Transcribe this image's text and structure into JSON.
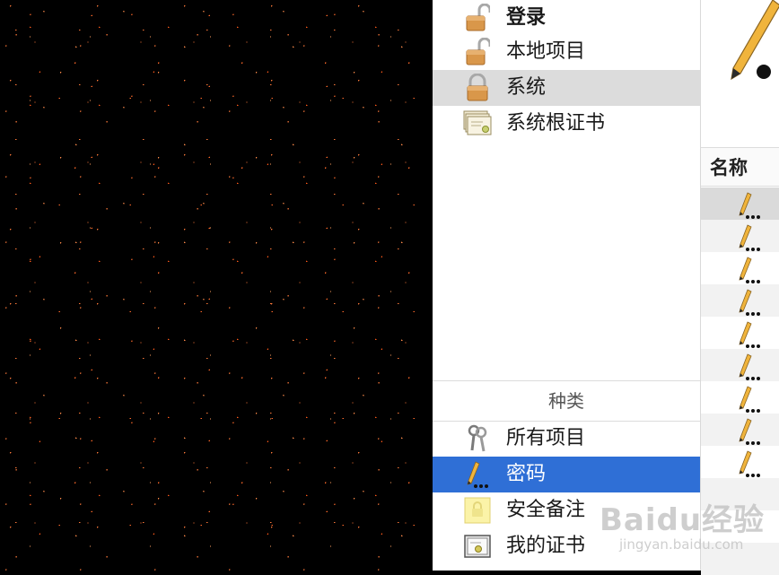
{
  "keychains": [
    {
      "label": "登录",
      "icon": "padlock-open-icon"
    },
    {
      "label": "本地项目",
      "icon": "padlock-open-icon"
    },
    {
      "label": "系统",
      "icon": "padlock-closed-icon"
    },
    {
      "label": "系统根证书",
      "icon": "certificate-stack-icon"
    }
  ],
  "category_header": "种类",
  "categories": [
    {
      "label": "所有项目",
      "icon": "keys-icon"
    },
    {
      "label": "密码",
      "icon": "pencil-icon"
    },
    {
      "label": "安全备注",
      "icon": "secure-note-icon"
    },
    {
      "label": "我的证书",
      "icon": "certificate-icon"
    }
  ],
  "column_header": "名称",
  "list_item_count_icons": [
    "pencil-icon",
    "pencil-icon",
    "pencil-icon",
    "pencil-icon",
    "pencil-icon",
    "pencil-icon",
    "pencil-icon",
    "pencil-icon",
    "pencil-icon"
  ],
  "watermark": {
    "main": "Baidu经验",
    "sub": "jingyan.baidu.com"
  },
  "colors": {
    "selection_blue": "#2f6fd6",
    "selection_grey": "#dcdcdc"
  }
}
